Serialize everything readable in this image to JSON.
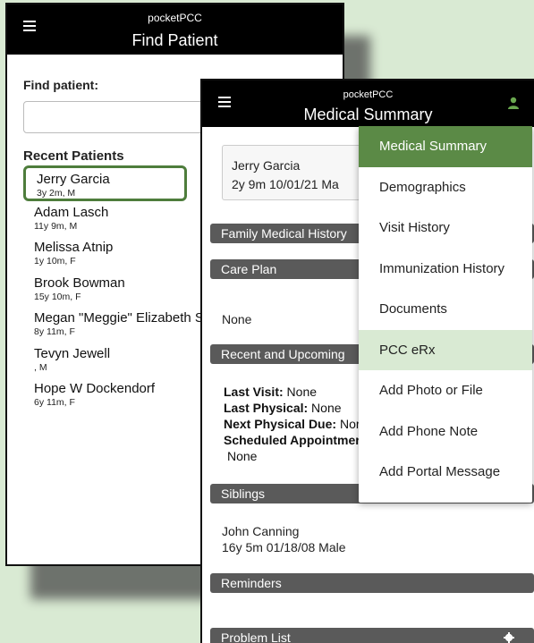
{
  "find_screen": {
    "app_name": "pocketPCC",
    "title": "Find Patient",
    "find_label": "Find patient:",
    "search_value": "",
    "recent_heading": "Recent Patients",
    "patients": [
      {
        "name": "Jerry Garcia",
        "info": "3y 2m, M"
      },
      {
        "name": "Adam Lasch",
        "info": "11y 9m, M"
      },
      {
        "name": "Melissa Atnip",
        "info": "1y 10m, F"
      },
      {
        "name": "Brook Bowman",
        "info": "15y 10m, F"
      },
      {
        "name": "Megan \"Meggie\" Elizabeth Sc",
        "info": "8y 11m, F"
      },
      {
        "name": "Tevyn Jewell",
        "info": ", M"
      },
      {
        "name": "Hope W Dockendorf",
        "info": "6y 11m, F"
      }
    ]
  },
  "summary_screen": {
    "app_name": "pocketPCC",
    "title": "Medical Summary",
    "patient_card": {
      "name": "Jerry Garcia",
      "details": "2y 9m  10/01/21  Ma"
    },
    "sections": {
      "family_history": "Family Medical History",
      "care_plan": "Care Plan",
      "care_plan_value": "None",
      "recent_upcoming": "Recent and Upcoming",
      "siblings": "Siblings",
      "reminders": "Reminders",
      "problem_list": "Problem List"
    },
    "visits": {
      "last_visit_label": "Last Visit:",
      "last_visit_value": " None",
      "last_physical_label": "Last Physical:",
      "last_physical_value": " None",
      "next_physical_label": "Next Physical Due:",
      "next_physical_value": " Nor",
      "scheduled_label": "Scheduled Appointmer",
      "scheduled_value": "None"
    },
    "sibling": {
      "name": "John Canning",
      "details": "16y 5m  01/18/08  Male"
    }
  },
  "menu": {
    "items": [
      {
        "label": "Medical Summary"
      },
      {
        "label": "Demographics"
      },
      {
        "label": "Visit History"
      },
      {
        "label": "Immunization History"
      },
      {
        "label": "Documents"
      },
      {
        "label": "PCC eRx"
      },
      {
        "label": "Add Photo or File"
      },
      {
        "label": "Add Phone Note"
      },
      {
        "label": "Add Portal Message"
      }
    ]
  },
  "colors": {
    "accent_green": "#5b8a46",
    "highlight_green": "#d9ead3",
    "selected_border": "#4e7d3c",
    "section_bar": "#5a5a5a"
  }
}
